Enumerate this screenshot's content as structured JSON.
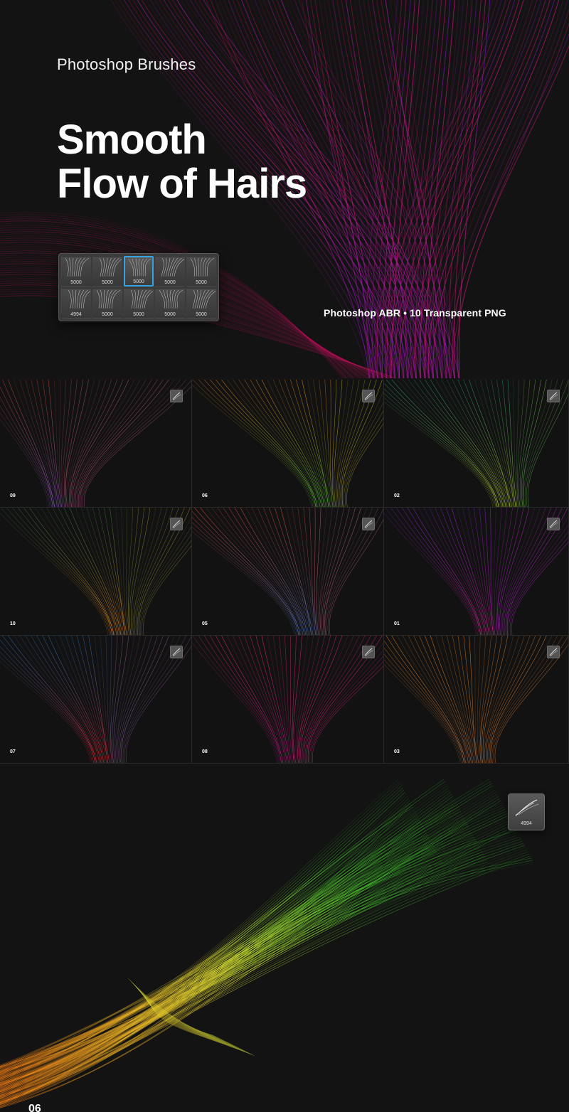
{
  "hero": {
    "subtitle": "Photoshop Brushes",
    "title_line1": "Smooth",
    "title_line2": "Flow of Hairs",
    "formats": "Photoshop ABR • 10 Transparent PNG",
    "brush_panel": {
      "cells": [
        {
          "count": "5000",
          "selected": false
        },
        {
          "count": "5000",
          "selected": false
        },
        {
          "count": "5000",
          "selected": true
        },
        {
          "count": "5000",
          "selected": false
        },
        {
          "count": "5000",
          "selected": false
        },
        {
          "count": "4994",
          "selected": false
        },
        {
          "count": "5000",
          "selected": false
        },
        {
          "count": "5000",
          "selected": false
        },
        {
          "count": "5000",
          "selected": false
        },
        {
          "count": "5000",
          "selected": false
        }
      ],
      "accent_color": "#34a3e0"
    }
  },
  "tiles": [
    {
      "num": "09",
      "colors": [
        "#c2452f",
        "#9a63d8"
      ]
    },
    {
      "num": "06",
      "colors": [
        "#ff8a1a",
        "#5ad033"
      ]
    },
    {
      "num": "02",
      "colors": [
        "#1f9c7a",
        "#c8e02c"
      ]
    },
    {
      "num": "10",
      "colors": [
        "#2f7a43",
        "#ff9420"
      ]
    },
    {
      "num": "05",
      "colors": [
        "#ff4a3a",
        "#5a7fd0"
      ]
    },
    {
      "num": "01",
      "colors": [
        "#9a1ef2",
        "#e02c9a"
      ]
    },
    {
      "num": "07",
      "colors": [
        "#1f7ad0",
        "#ff2a3a"
      ]
    },
    {
      "num": "08",
      "colors": [
        "#ff2a7a",
        "#c21a8a"
      ]
    },
    {
      "num": "03",
      "colors": [
        "#ff8a1a",
        "#c27a4a"
      ]
    }
  ],
  "big_preview": {
    "num": "06",
    "thumb_count": "4994",
    "colors": [
      "#ff7a10",
      "#e6e230",
      "#3fc22a"
    ]
  }
}
